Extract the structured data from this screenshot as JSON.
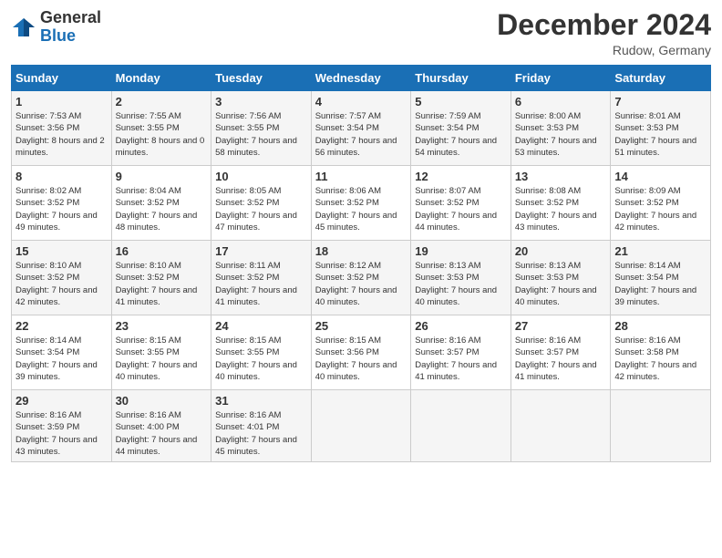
{
  "header": {
    "logo_general": "General",
    "logo_blue": "Blue",
    "title": "December 2024",
    "location": "Rudow, Germany"
  },
  "columns": [
    "Sunday",
    "Monday",
    "Tuesday",
    "Wednesday",
    "Thursday",
    "Friday",
    "Saturday"
  ],
  "weeks": [
    [
      {
        "day": "1",
        "sunrise": "7:53 AM",
        "sunset": "3:56 PM",
        "daylight": "8 hours and 2 minutes."
      },
      {
        "day": "2",
        "sunrise": "7:55 AM",
        "sunset": "3:55 PM",
        "daylight": "8 hours and 0 minutes."
      },
      {
        "day": "3",
        "sunrise": "7:56 AM",
        "sunset": "3:55 PM",
        "daylight": "7 hours and 58 minutes."
      },
      {
        "day": "4",
        "sunrise": "7:57 AM",
        "sunset": "3:54 PM",
        "daylight": "7 hours and 56 minutes."
      },
      {
        "day": "5",
        "sunrise": "7:59 AM",
        "sunset": "3:54 PM",
        "daylight": "7 hours and 54 minutes."
      },
      {
        "day": "6",
        "sunrise": "8:00 AM",
        "sunset": "3:53 PM",
        "daylight": "7 hours and 53 minutes."
      },
      {
        "day": "7",
        "sunrise": "8:01 AM",
        "sunset": "3:53 PM",
        "daylight": "7 hours and 51 minutes."
      }
    ],
    [
      {
        "day": "8",
        "sunrise": "8:02 AM",
        "sunset": "3:52 PM",
        "daylight": "7 hours and 49 minutes."
      },
      {
        "day": "9",
        "sunrise": "8:04 AM",
        "sunset": "3:52 PM",
        "daylight": "7 hours and 48 minutes."
      },
      {
        "day": "10",
        "sunrise": "8:05 AM",
        "sunset": "3:52 PM",
        "daylight": "7 hours and 47 minutes."
      },
      {
        "day": "11",
        "sunrise": "8:06 AM",
        "sunset": "3:52 PM",
        "daylight": "7 hours and 45 minutes."
      },
      {
        "day": "12",
        "sunrise": "8:07 AM",
        "sunset": "3:52 PM",
        "daylight": "7 hours and 44 minutes."
      },
      {
        "day": "13",
        "sunrise": "8:08 AM",
        "sunset": "3:52 PM",
        "daylight": "7 hours and 43 minutes."
      },
      {
        "day": "14",
        "sunrise": "8:09 AM",
        "sunset": "3:52 PM",
        "daylight": "7 hours and 42 minutes."
      }
    ],
    [
      {
        "day": "15",
        "sunrise": "8:10 AM",
        "sunset": "3:52 PM",
        "daylight": "7 hours and 42 minutes."
      },
      {
        "day": "16",
        "sunrise": "8:10 AM",
        "sunset": "3:52 PM",
        "daylight": "7 hours and 41 minutes."
      },
      {
        "day": "17",
        "sunrise": "8:11 AM",
        "sunset": "3:52 PM",
        "daylight": "7 hours and 41 minutes."
      },
      {
        "day": "18",
        "sunrise": "8:12 AM",
        "sunset": "3:52 PM",
        "daylight": "7 hours and 40 minutes."
      },
      {
        "day": "19",
        "sunrise": "8:13 AM",
        "sunset": "3:53 PM",
        "daylight": "7 hours and 40 minutes."
      },
      {
        "day": "20",
        "sunrise": "8:13 AM",
        "sunset": "3:53 PM",
        "daylight": "7 hours and 40 minutes."
      },
      {
        "day": "21",
        "sunrise": "8:14 AM",
        "sunset": "3:54 PM",
        "daylight": "7 hours and 39 minutes."
      }
    ],
    [
      {
        "day": "22",
        "sunrise": "8:14 AM",
        "sunset": "3:54 PM",
        "daylight": "7 hours and 39 minutes."
      },
      {
        "day": "23",
        "sunrise": "8:15 AM",
        "sunset": "3:55 PM",
        "daylight": "7 hours and 40 minutes."
      },
      {
        "day": "24",
        "sunrise": "8:15 AM",
        "sunset": "3:55 PM",
        "daylight": "7 hours and 40 minutes."
      },
      {
        "day": "25",
        "sunrise": "8:15 AM",
        "sunset": "3:56 PM",
        "daylight": "7 hours and 40 minutes."
      },
      {
        "day": "26",
        "sunrise": "8:16 AM",
        "sunset": "3:57 PM",
        "daylight": "7 hours and 41 minutes."
      },
      {
        "day": "27",
        "sunrise": "8:16 AM",
        "sunset": "3:57 PM",
        "daylight": "7 hours and 41 minutes."
      },
      {
        "day": "28",
        "sunrise": "8:16 AM",
        "sunset": "3:58 PM",
        "daylight": "7 hours and 42 minutes."
      }
    ],
    [
      {
        "day": "29",
        "sunrise": "8:16 AM",
        "sunset": "3:59 PM",
        "daylight": "7 hours and 43 minutes."
      },
      {
        "day": "30",
        "sunrise": "8:16 AM",
        "sunset": "4:00 PM",
        "daylight": "7 hours and 44 minutes."
      },
      {
        "day": "31",
        "sunrise": "8:16 AM",
        "sunset": "4:01 PM",
        "daylight": "7 hours and 45 minutes."
      },
      null,
      null,
      null,
      null
    ]
  ]
}
